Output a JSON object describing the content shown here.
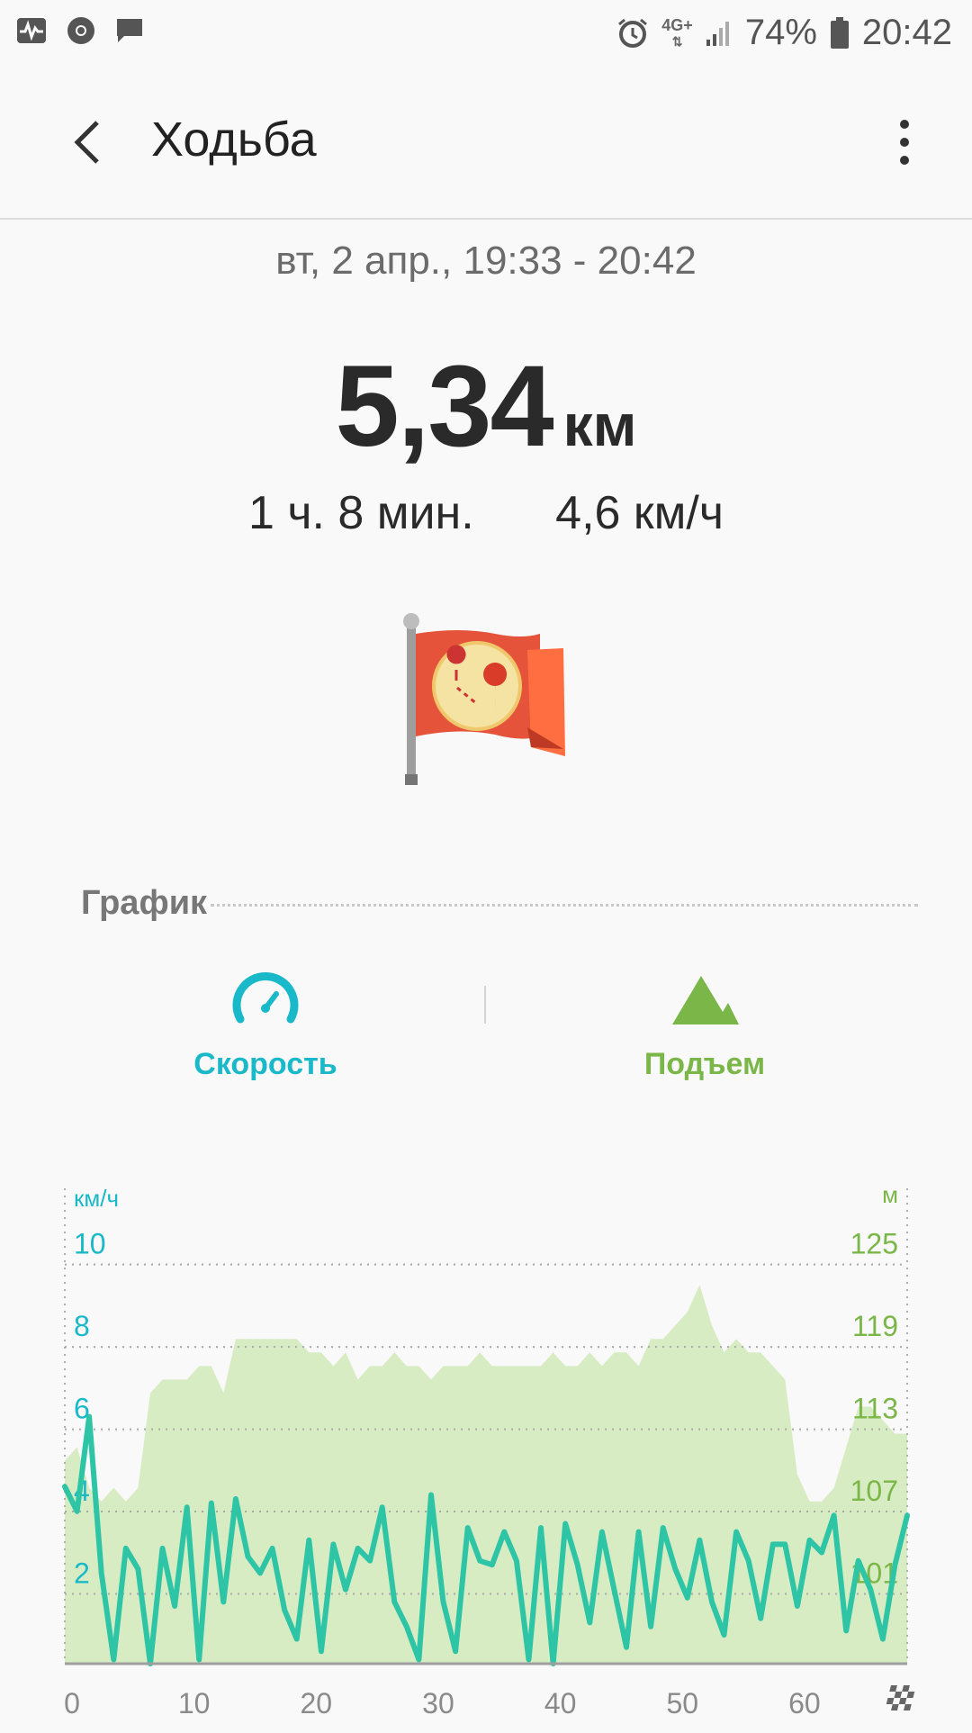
{
  "status_bar": {
    "network": "4G+",
    "battery": "74%",
    "time": "20:42"
  },
  "header": {
    "title": "Ходьба"
  },
  "workout": {
    "date_range": "вт, 2 апр., 19:33 - 20:42",
    "distance_value": "5,34",
    "distance_unit": "км",
    "duration": "1 ч. 8 мин.",
    "avg_speed": "4,6 км/ч"
  },
  "section": {
    "label": "График"
  },
  "tabs": {
    "speed_label": "Скорость",
    "elevation_label": "Подъем"
  },
  "colors": {
    "speed": "#19b9c9",
    "speed_line": "#2ec4a6",
    "elevation": "#7ab648",
    "elevation_fill": "#d8ecc4"
  },
  "chart_data": {
    "type": "area",
    "x_ticks": [
      "0",
      "10",
      "20",
      "30",
      "40",
      "50",
      "60"
    ],
    "xlim": [
      0,
      69
    ],
    "left_axis": {
      "unit": "км/ч",
      "ticks": [
        "10",
        "8",
        "6",
        "4",
        "2"
      ],
      "ylim": [
        0,
        11.5
      ]
    },
    "right_axis": {
      "unit": "м",
      "ticks": [
        "125",
        "119",
        "113",
        "107",
        "101"
      ],
      "ylim": [
        95,
        130
      ]
    },
    "grid": "dotted horizontal",
    "series": [
      {
        "axis": "right",
        "x": [
          0,
          1,
          2,
          3,
          4,
          5,
          6,
          7,
          8,
          9,
          10,
          11,
          12,
          13,
          14,
          15,
          16,
          17,
          18,
          19,
          20,
          21,
          22,
          23,
          24,
          25,
          26,
          27,
          28,
          29,
          30,
          31,
          32,
          33,
          34,
          35,
          36,
          37,
          38,
          39,
          40,
          41,
          42,
          43,
          44,
          45,
          46,
          47,
          48,
          49,
          50,
          51,
          52,
          53,
          54,
          55,
          56,
          57,
          58,
          59,
          60,
          61,
          62,
          63,
          64,
          65,
          66,
          67,
          68,
          69
        ],
        "y": [
          110,
          111,
          108,
          107,
          108,
          107,
          108,
          115,
          116,
          116,
          116,
          117,
          117,
          115,
          119,
          119,
          119,
          119,
          119,
          119,
          118,
          118,
          117,
          118,
          116,
          117,
          117,
          118,
          117,
          117,
          116,
          117,
          117,
          117,
          118,
          117,
          117,
          117,
          117,
          117,
          118,
          117,
          117,
          118,
          117,
          118,
          118,
          117,
          119,
          119,
          120,
          121,
          123,
          120,
          118,
          119,
          118,
          118,
          117,
          116,
          109,
          107,
          107,
          108,
          111,
          114,
          114,
          113,
          112,
          112
        ]
      },
      {
        "axis": "left",
        "x": [
          0,
          1,
          2,
          3,
          4,
          5,
          6,
          7,
          8,
          9,
          10,
          11,
          12,
          13,
          14,
          15,
          16,
          17,
          18,
          19,
          20,
          21,
          22,
          23,
          24,
          25,
          26,
          27,
          28,
          29,
          30,
          31,
          32,
          33,
          34,
          35,
          36,
          37,
          38,
          39,
          40,
          41,
          42,
          43,
          44,
          45,
          46,
          47,
          48,
          49,
          50,
          51,
          52,
          53,
          54,
          55,
          56,
          57,
          58,
          59,
          60,
          61,
          62,
          63,
          64,
          65,
          66,
          67,
          68,
          69
        ],
        "y": [
          4.3,
          3.7,
          6.0,
          2.2,
          0.1,
          2.8,
          2.3,
          0.0,
          2.8,
          1.4,
          3.8,
          0.1,
          3.9,
          1.5,
          4.0,
          2.6,
          2.2,
          2.8,
          1.3,
          0.6,
          3.0,
          0.3,
          2.9,
          1.8,
          2.8,
          2.5,
          3.8,
          1.5,
          0.9,
          0.1,
          4.1,
          1.5,
          0.3,
          3.3,
          2.5,
          2.4,
          3.2,
          2.5,
          0.1,
          3.3,
          0.0,
          3.4,
          2.4,
          1.0,
          3.2,
          1.8,
          0.4,
          3.2,
          0.9,
          3.3,
          2.3,
          1.6,
          3.0,
          1.5,
          0.7,
          3.2,
          2.5,
          1.1,
          2.9,
          2.9,
          1.4,
          3.0,
          2.7,
          3.6,
          0.8,
          2.5,
          1.8,
          0.6,
          2.4,
          3.6
        ]
      }
    ]
  }
}
